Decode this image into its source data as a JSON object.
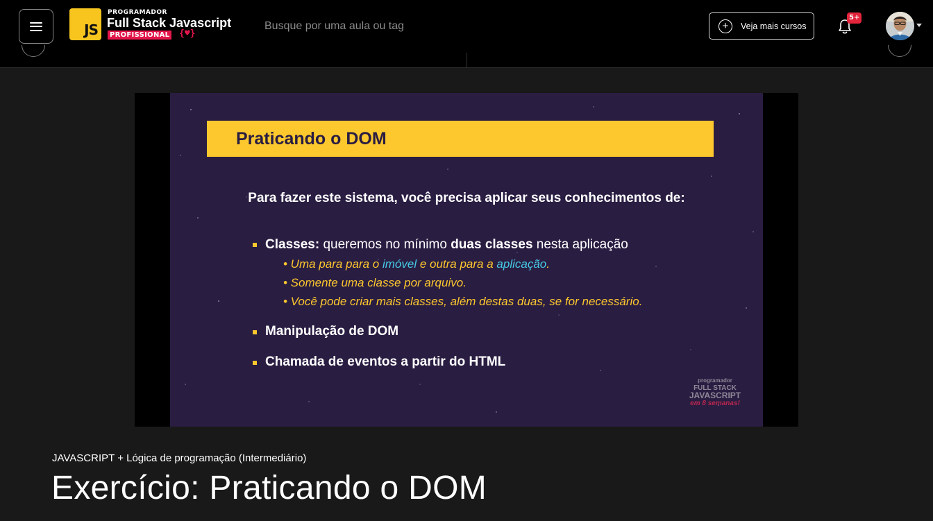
{
  "header": {
    "menu_icon": "hamburger-menu-icon",
    "logo": {
      "badge": "JS",
      "pre": "PROGRAMADOR",
      "main": "Full Stack Javascript",
      "tag": "PROFISSIONAL",
      "brace": "{♥}"
    },
    "search": {
      "placeholder": "Busque por uma aula ou tag",
      "value": ""
    },
    "more_courses_label": "Veja mais cursos",
    "notifications": {
      "icon": "bell-icon",
      "badge": "5+"
    },
    "avatar_icon": "user-avatar",
    "caret_icon": "chevron-down-icon"
  },
  "slide": {
    "title": "Praticando o DOM",
    "intro": "Para fazer este sistema, você precisa aplicar seus conhecimentos de:",
    "bullet1": {
      "strong": "Classes:",
      "text1": " queremos no mínimo ",
      "strong2": "duas classes",
      "text2": " nesta aplicação",
      "subs": {
        "s1a": "• Uma para para o ",
        "s1b": "imóvel",
        "s1c": " e outra para a ",
        "s1d": "aplicação",
        "s1e": ".",
        "s2": "• Somente uma classe por arquivo.",
        "s3": "• Você pode criar mais classes, além destas duas, se for necessário."
      }
    },
    "bullet2": "Manipulação de DOM",
    "bullet3": "Chamada de eventos a partir do HTML",
    "watermark": {
      "a": "programador",
      "b": "FULL STACK",
      "c": "JAVASCRIPT",
      "d": "em 8 semanas!"
    }
  },
  "course": {
    "name": "JAVASCRIPT + Lógica de programação (Intermediário)",
    "lesson_title": "Exercício: Praticando o DOM"
  },
  "colors": {
    "accent": "#fdc82d",
    "brand_red": "#e3164a",
    "slide_bg": "#2a1d42",
    "link_cyan": "#46cbe6",
    "page_bg": "#191919"
  }
}
